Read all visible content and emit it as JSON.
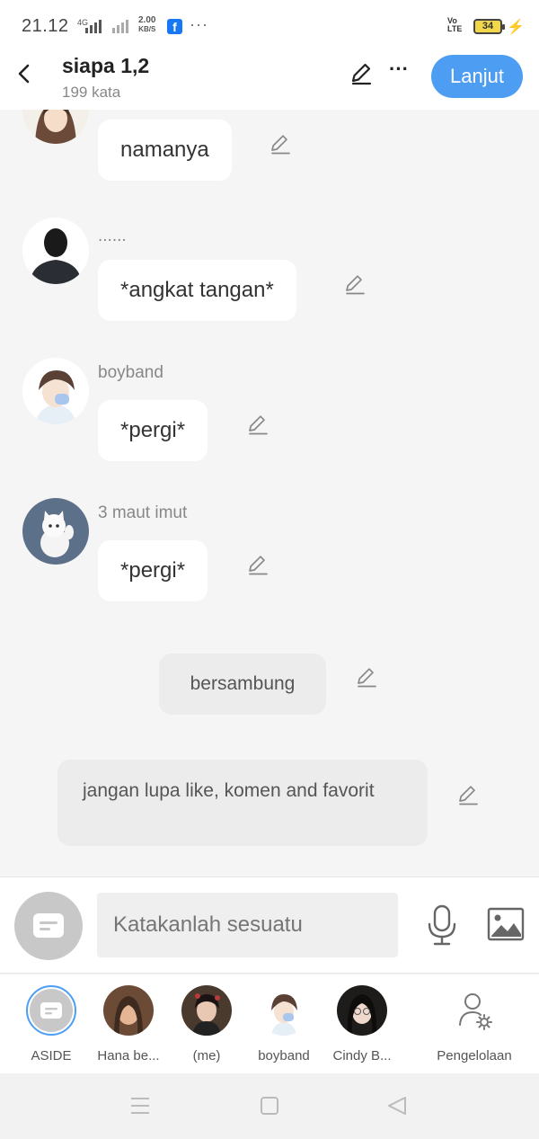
{
  "status_bar": {
    "time": "21.12",
    "net1": "4G",
    "speed_value": "2.00",
    "speed_unit": "KB/S",
    "fb": "f",
    "dots": "···",
    "volte": "Vo\nLTE",
    "battery": "34"
  },
  "header": {
    "title": "siapa 1,2",
    "subtitle": "199 kata",
    "next_label": "Lanjut"
  },
  "messages": [
    {
      "sender": "",
      "text": "namanya"
    },
    {
      "sender": "......",
      "text": "*angkat tangan*"
    },
    {
      "sender": "boyband",
      "text": "*pergi*"
    },
    {
      "sender": "3 maut imut",
      "text": "*pergi*"
    }
  ],
  "narration": [
    {
      "text": "bersambung"
    },
    {
      "text": "jangan lupa like, komen and favorit"
    }
  ],
  "input": {
    "placeholder": "Katakanlah sesuatu"
  },
  "characters": [
    {
      "label": "ASIDE"
    },
    {
      "label": "Hana be..."
    },
    {
      "label": "(me)"
    },
    {
      "label": "boyband"
    },
    {
      "label": "Cindy B..."
    },
    {
      "label": "Pengelolaan"
    }
  ],
  "colors": {
    "accent": "#4d9ef2",
    "bubble": "#ffffff",
    "chat_bg": "#f5f5f5",
    "narration_bg": "#ececec"
  }
}
